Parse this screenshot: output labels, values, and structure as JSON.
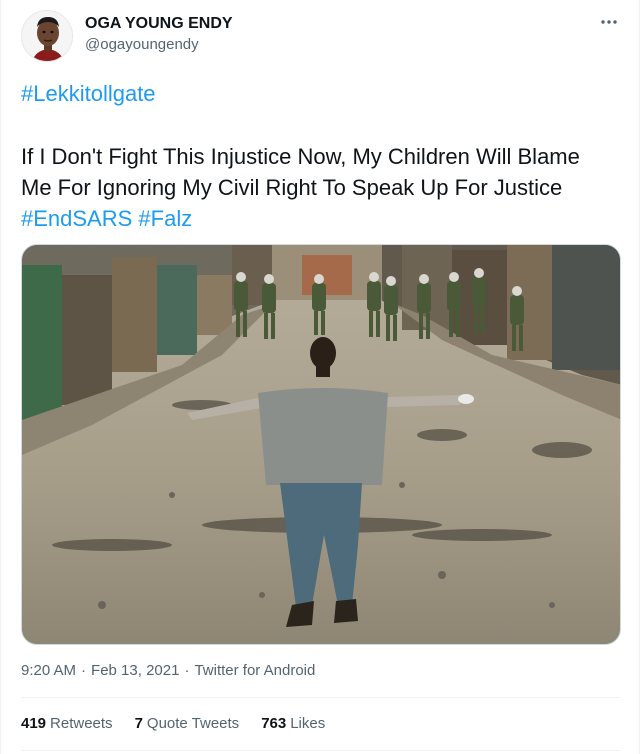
{
  "author": {
    "display_name": "OGA YOUNG ENDY",
    "handle": "@ogayoungendy",
    "avatar_icon": "cartoon-avatar-icon"
  },
  "tweet": {
    "hashtag_top": "#Lekkitollgate",
    "body_line1": "If I Don't Fight This Injustice Now,  My Children Will Blame",
    "body_line2": "Me For Ignoring My Civil Right To Speak Up For Justice",
    "hashtag_endsars": "#EndSARS",
    "hashtag_falz": "#Falz"
  },
  "media": {
    "type": "photo"
  },
  "meta": {
    "time": "9:20 AM",
    "separator": "·",
    "date": "Feb 13, 2021",
    "source": "Twitter for Android"
  },
  "stats": {
    "retweets_count": "419",
    "retweets_label": "Retweets",
    "quotes_count": "7",
    "quotes_label": "Quote Tweets",
    "likes_count": "763",
    "likes_label": "Likes"
  },
  "colors": {
    "link": "#1d9bf0",
    "secondary_text": "#536471",
    "primary_text": "#0f1419",
    "divider": "#eff3f4"
  }
}
